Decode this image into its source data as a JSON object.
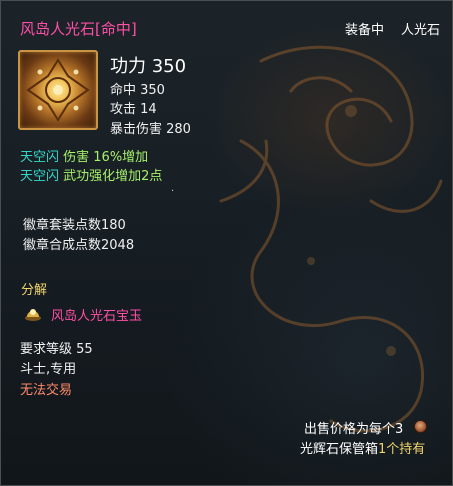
{
  "item": {
    "name": "风岛人光石[命中]",
    "state": "装备中",
    "type": "人光石",
    "icon": "gold-ornament-gem-icon"
  },
  "stats": {
    "main": "功力 350",
    "lines": [
      "命中 350",
      "攻击 14",
      "暴击伤害 280"
    ]
  },
  "effects": [
    {
      "source": "天空闪",
      "text": "伤害 16%增加"
    },
    {
      "source": "天空闪",
      "text": "武功强化增加2点"
    }
  ],
  "emblem": {
    "set_points": "徽章套装点数180",
    "synth_points": "徽章合成点数2048"
  },
  "disassemble": {
    "label": "分解",
    "item": "风岛人光石宝玉",
    "icon": "treasure-jade-icon"
  },
  "requirements": {
    "level": "要求等级 55",
    "class": "斗士,专用",
    "trade": "无法交易"
  },
  "footer": {
    "sell": "出售价格为每个3",
    "storage_text": "光辉石保管箱",
    "storage_hold": "1个持有",
    "coin_icon": "copper-coin-icon"
  },
  "colors": {
    "name": "#ff4fa7",
    "effect_source": "#33d6c6",
    "effect_text": "#a6f06a",
    "section_header": "#f1d56b",
    "no_trade": "#ff8a6b"
  }
}
